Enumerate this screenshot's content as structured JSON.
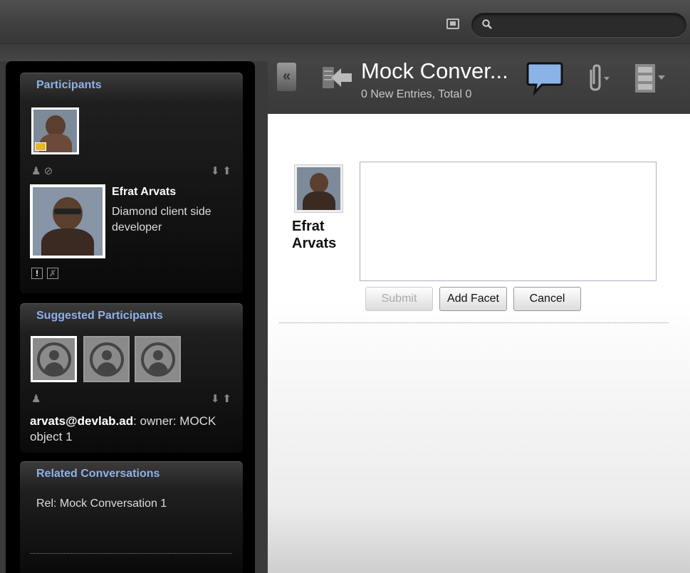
{
  "search": {
    "value": "",
    "placeholder": ""
  },
  "participants": {
    "title": "Participants",
    "person": {
      "name": "Efrat Arvats",
      "role": "Diamond client side developer"
    },
    "icon_exclaim": "!"
  },
  "suggested": {
    "title": "Suggested Participants",
    "owner_user": "arvats@devlab.ad",
    "owner_text": ": owner: MOCK object 1"
  },
  "related": {
    "title": "Related Conversations",
    "items": [
      "Rel: Mock Conversation 1"
    ]
  },
  "header": {
    "collapse_label": "«",
    "title": "Mock Conver...",
    "subtitle": "0 New Entries, Total 0"
  },
  "entry": {
    "name_line1": "Efrat",
    "name_line2": "Arvats",
    "text_value": "",
    "buttons": {
      "submit": "Submit",
      "add_facet": "Add Facet",
      "cancel": "Cancel"
    }
  },
  "icons": {
    "topbar": [
      "video-icon",
      "search-icon"
    ],
    "participants": [
      "add-person-icon",
      "block-icon",
      "arrow-down-icon",
      "arrow-up-icon",
      "crown-icon",
      "alert-icon",
      "unavailable-icon"
    ],
    "header": [
      "back-arrow-icon",
      "chat-bubble-icon",
      "paperclip-icon",
      "archive-icon"
    ]
  },
  "colors": {
    "section_title": "#8fb0e8",
    "chat_bubble": "#8ab4e8",
    "crown": "#e4b828"
  }
}
